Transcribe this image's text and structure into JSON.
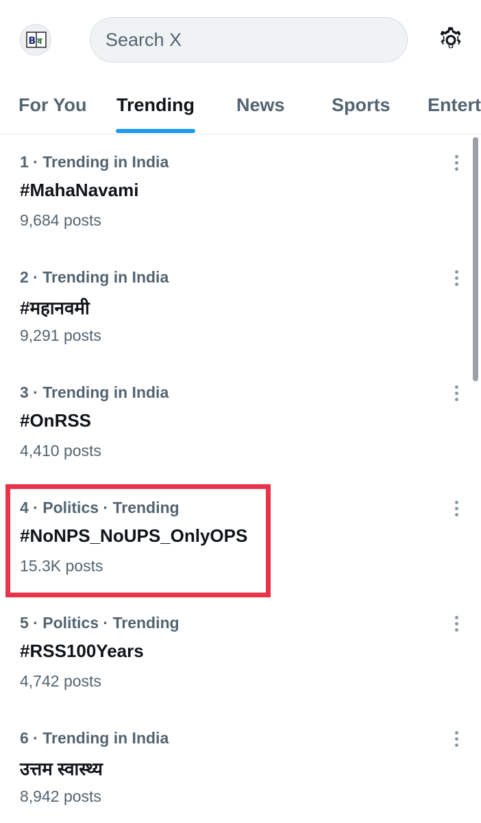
{
  "header": {
    "avatar_text": "Bव",
    "search_placeholder": "Search X"
  },
  "tabs": [
    {
      "label": "For You",
      "active": false
    },
    {
      "label": "Trending",
      "active": true
    },
    {
      "label": "News",
      "active": false
    },
    {
      "label": "Sports",
      "active": false
    },
    {
      "label": "Entert",
      "active": false
    }
  ],
  "trends": [
    {
      "meta": "1 · Trending in India",
      "title": "#MahaNavami",
      "count": "9,684 posts"
    },
    {
      "meta": "2 · Trending in India",
      "title": "#महानवमी",
      "count": "9,291 posts"
    },
    {
      "meta": "3 · Trending in India",
      "title": "#OnRSS",
      "count": "4,410 posts"
    },
    {
      "meta": "4 · Politics · Trending",
      "title": "#NoNPS_NoUPS_OnlyOPS",
      "count": "15.3K posts"
    },
    {
      "meta": "5 · Politics · Trending",
      "title": "#RSS100Years",
      "count": "4,742 posts"
    },
    {
      "meta": "6 · Trending in India",
      "title": "उत्तम स्वास्थ्य",
      "count": "8,942 posts"
    }
  ],
  "colors": {
    "accent": "#1d9bf0",
    "highlight_border": "#e7344a",
    "secondary_text": "#536471"
  },
  "icons": {
    "settings": "gear-icon",
    "more": "more-vertical-icon"
  }
}
